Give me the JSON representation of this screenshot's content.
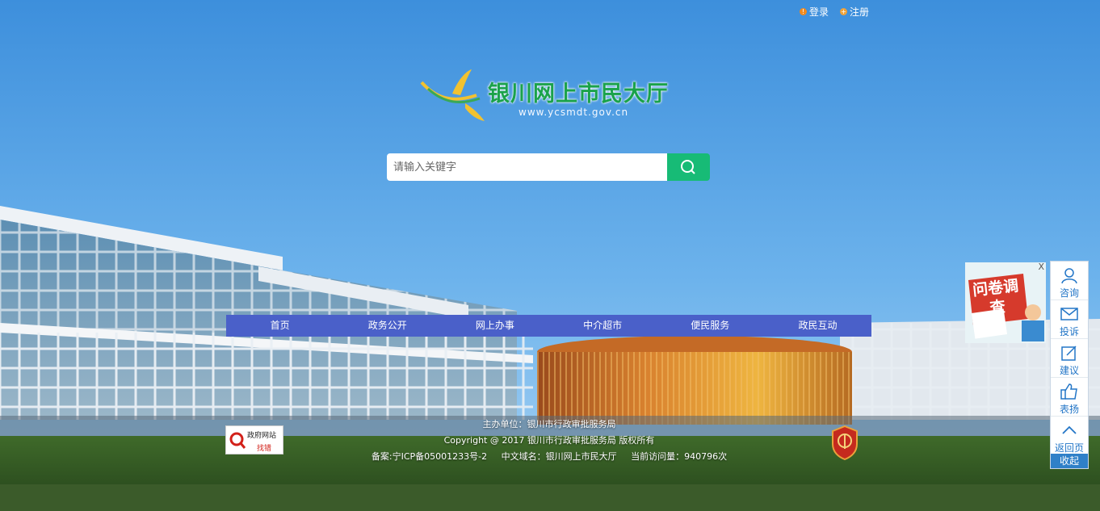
{
  "topbar": {
    "login_label": "登录",
    "register_label": "注册"
  },
  "logo": {
    "title": "银川网上市民大厅",
    "url": "www.ycsmdt.gov.cn"
  },
  "search": {
    "placeholder": "请输入关键字"
  },
  "nav": {
    "items": [
      "首页",
      "政务公开",
      "网上办事",
      "中介超市",
      "便民服务",
      "政民互动"
    ]
  },
  "footer": {
    "sponsor": "主办单位：银川市行政审批服务局",
    "copyright": "Copyright @ 2017 银川市行政审批服务局 版权所有",
    "icp": "备案:宁ICP备05001233号-2",
    "cn_domain": "中文域名：银川网上市民大厅",
    "visits": "当前访问量：940796次"
  },
  "gov_badge": {
    "line1": "政府网站",
    "line2": "找错"
  },
  "survey": {
    "text": "问卷调查",
    "close_label": "X"
  },
  "sidebar": {
    "items": [
      {
        "label": "咨询",
        "icon": "person-icon"
      },
      {
        "label": "投诉",
        "icon": "mail-icon"
      },
      {
        "label": "建议",
        "icon": "edit-icon"
      },
      {
        "label": "表扬",
        "icon": "thumbs-up-icon"
      },
      {
        "label": "返回页",
        "icon": "chevron-up-icon"
      }
    ],
    "collapse_label": "收起"
  },
  "colors": {
    "nav_bg": "#4a60c9",
    "search_button": "#17bb76",
    "logo_green": "#1aa24a",
    "sidebar_blue": "#2f80c8"
  }
}
